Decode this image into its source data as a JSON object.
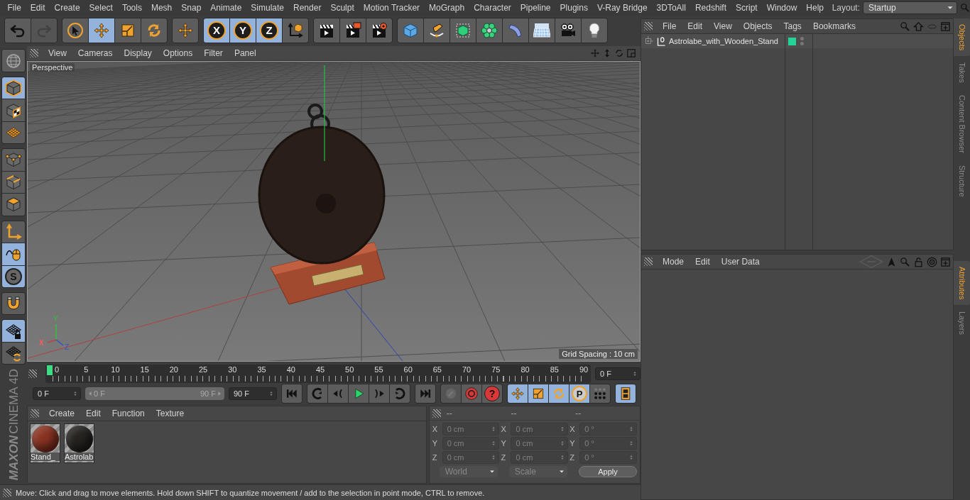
{
  "menu": [
    "File",
    "Edit",
    "Create",
    "Select",
    "Tools",
    "Mesh",
    "Snap",
    "Animate",
    "Simulate",
    "Render",
    "Sculpt",
    "Motion Tracker",
    "MoGraph",
    "Character",
    "Pipeline",
    "Plugins",
    "V-Ray Bridge",
    "3DToAll",
    "Redshift",
    "Script",
    "Window",
    "Help"
  ],
  "layout": {
    "label": "Layout:",
    "value": "Startup"
  },
  "toolbar": [
    [
      {
        "disabled": false
      },
      {
        "disabled": true
      }
    ],
    [
      {
        "selected": false
      },
      {
        "selected": true
      },
      {
        "selected": false
      },
      {
        "selected": false
      }
    ],
    [
      {
        "selected": false
      }
    ],
    [
      {
        "selected": true,
        "label": "X"
      },
      {
        "selected": true,
        "label": "Y"
      },
      {
        "selected": true,
        "label": "Z"
      },
      {
        "selected": false
      }
    ],
    [
      {
        "selected": false
      },
      {
        "selected": false
      },
      {
        "selected": false
      }
    ],
    [
      {
        "selected": false
      },
      {
        "selected": false
      },
      {
        "selected": false
      },
      {
        "selected": false
      },
      {
        "selected": false
      },
      {
        "selected": false
      },
      {
        "selected": false
      },
      {
        "selected": false
      }
    ]
  ],
  "left_tools": [
    [
      {
        "selected": false
      }
    ],
    [
      {
        "selected": true
      },
      {
        "selected": false
      },
      {
        "selected": false
      }
    ],
    [
      {
        "selected": false
      },
      {
        "selected": false
      },
      {
        "selected": false
      }
    ],
    [
      {
        "selected": false
      },
      {
        "selected": true
      },
      {
        "selected": true,
        "label": "S"
      }
    ],
    [
      {
        "selected": false
      }
    ],
    [
      {
        "selected": true
      },
      {
        "selected": false
      }
    ]
  ],
  "logo": {
    "brand": "MAXON",
    "product": "CINEMA 4D"
  },
  "viewport": {
    "menu": [
      "View",
      "Cameras",
      "Display",
      "Options",
      "Filter",
      "Panel"
    ],
    "camera": "Perspective",
    "grid_spacing": "Grid Spacing : 10 cm",
    "axis_gizmo": {
      "x": "X",
      "y": "Y",
      "z": "Z"
    }
  },
  "timeline": {
    "ticks": [
      "0",
      "5",
      "10",
      "15",
      "20",
      "25",
      "30",
      "35",
      "40",
      "45",
      "50",
      "55",
      "60",
      "65",
      "70",
      "75",
      "80",
      "85",
      "90"
    ],
    "level": 0,
    "current": "0 F"
  },
  "playback": {
    "start": "0 F",
    "range": {
      "start": "0 F",
      "end": "90 F",
      "level": 1
    },
    "end": "90 F",
    "key_buttons": [
      {
        "disabled": true
      },
      {
        "disabled": false
      },
      {
        "disabled": false,
        "label": "?"
      }
    ],
    "key_tracks": [
      {
        "selected": true
      },
      {
        "selected": true
      },
      {
        "selected": true
      },
      {
        "selected": true,
        "label": "P"
      },
      {
        "selected": false
      }
    ],
    "timeline_button": {
      "selected": true
    }
  },
  "materials": {
    "menu": [
      "Create",
      "Edit",
      "Function",
      "Texture"
    ],
    "items": [
      {
        "name": "Stand_",
        "color": "#8a3322"
      },
      {
        "name": "Astrolab",
        "color": "#262320"
      }
    ]
  },
  "coordinates": {
    "headers": [
      "--",
      "--",
      "--"
    ],
    "rows": [
      [
        {
          "axis": "X",
          "value": "0 cm",
          "disabled": true
        },
        {
          "axis": "X",
          "value": "0 cm",
          "disabled": true
        },
        {
          "axis": "X",
          "value": "0 °",
          "disabled": true
        }
      ],
      [
        {
          "axis": "Y",
          "value": "0 cm",
          "disabled": true
        },
        {
          "axis": "Y",
          "value": "0 cm",
          "disabled": true
        },
        {
          "axis": "Y",
          "value": "0 °",
          "disabled": true
        }
      ],
      [
        {
          "axis": "Z",
          "value": "0 cm",
          "disabled": true
        },
        {
          "axis": "Z",
          "value": "0 cm",
          "disabled": true
        },
        {
          "axis": "Z",
          "value": "0 °",
          "disabled": true
        }
      ]
    ],
    "dropdowns": [
      {
        "value": "World",
        "disabled": true
      },
      {
        "value": "Scale",
        "disabled": true
      }
    ],
    "apply": "Apply"
  },
  "status": "Move: Click and drag to move elements. Hold down SHIFT to quantize movement / add to the selection in point mode, CTRL to remove.",
  "objects": {
    "menu": [
      "File",
      "Edit",
      "View",
      "Objects",
      "Tags",
      "Bookmarks"
    ],
    "items": [
      {
        "name": "Astrolabe_with_Wooden_Stand",
        "expanded": false
      }
    ]
  },
  "attributes": {
    "menu": [
      "Mode",
      "Edit",
      "User Data"
    ]
  },
  "side_tabs_top": [
    {
      "label": "Objects",
      "selected": true
    },
    {
      "label": "Takes",
      "selected": false
    },
    {
      "label": "Content Browser",
      "selected": false
    },
    {
      "label": "Structure",
      "selected": false
    }
  ],
  "side_tabs_bottom": [
    {
      "label": "Attributes",
      "selected": true
    },
    {
      "label": "Layers",
      "selected": false
    }
  ]
}
